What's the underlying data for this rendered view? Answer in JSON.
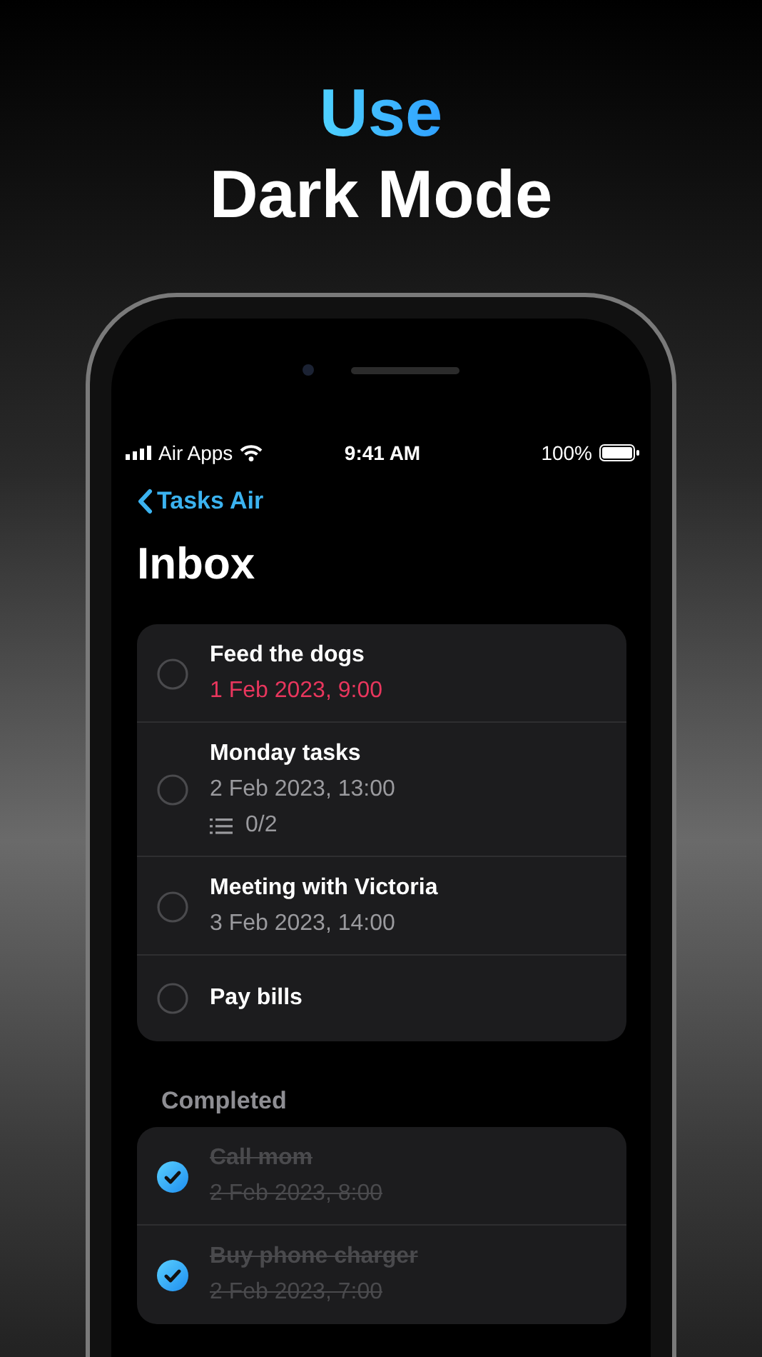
{
  "headline": {
    "accent": "Use",
    "title": "Dark Mode"
  },
  "status_bar": {
    "carrier": "Air Apps",
    "time": "9:41 AM",
    "battery": "100%"
  },
  "nav": {
    "back": "Tasks Air",
    "title": "Inbox"
  },
  "tasks": [
    {
      "title": "Feed the dogs",
      "due": "1 Feb 2023, 9:00",
      "overdue": true,
      "done": false
    },
    {
      "title": "Monday tasks",
      "due": "2 Feb 2023, 13:00",
      "overdue": false,
      "checklist": "0/2",
      "done": false
    },
    {
      "title": "Meeting with Victoria",
      "due": "3 Feb 2023, 14:00",
      "overdue": false,
      "done": false
    },
    {
      "title": "Pay bills",
      "done": false
    }
  ],
  "completed": {
    "title": "Completed",
    "tasks": [
      {
        "title": "Call mom",
        "due": "2 Feb 2023, 8:00",
        "overdue": false,
        "done": true
      },
      {
        "title": "Buy phone charger",
        "due": "2 Feb 2023, 7:00",
        "overdue": false,
        "done": true
      }
    ]
  }
}
